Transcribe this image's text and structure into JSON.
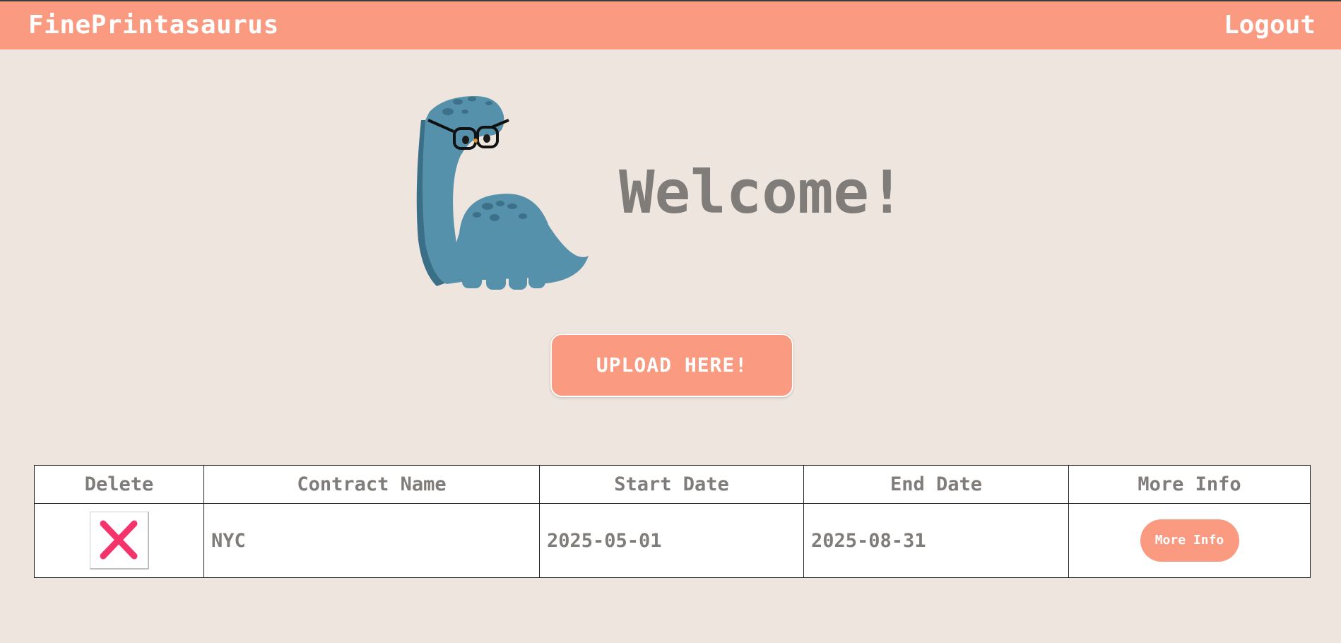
{
  "app": {
    "brand": "FinePrintasaurus",
    "logout_label": "Logout"
  },
  "hero": {
    "welcome": "Welcome!",
    "mascot_icon": "dinosaur-with-glasses"
  },
  "upload": {
    "label": "UPLOAD HERE!"
  },
  "table": {
    "headers": [
      "Delete",
      "Contract Name",
      "Start Date",
      "End Date",
      "More Info"
    ],
    "rows": [
      {
        "delete_icon": "close-x-icon",
        "contract_name": "NYC",
        "start_date": "2025-05-01",
        "end_date": "2025-08-31",
        "more_info_label": "More Info"
      }
    ]
  },
  "colors": {
    "accent": "#f99a81",
    "background": "#ede5de",
    "text_gray": "#7f7c79",
    "delete_red": "#f4346a",
    "dino_blue": "#5691ab"
  }
}
